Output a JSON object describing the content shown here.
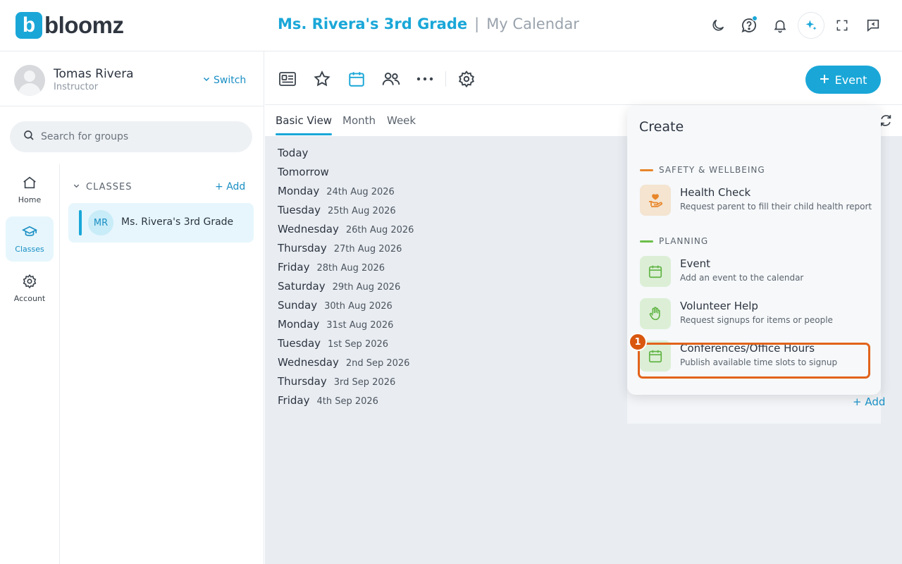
{
  "brand": {
    "logo_letter": "b",
    "name": "bloomz",
    "color": "#1aa7d8"
  },
  "header": {
    "group": "Ms. Rivera's 3rd Grade",
    "separator": "|",
    "page": "My Calendar"
  },
  "top_icons": [
    "moon-icon",
    "help-icon",
    "bell-icon",
    "ai-sparkle-icon",
    "fullscreen-icon",
    "message-icon"
  ],
  "user": {
    "name": "Tomas Rivera",
    "role": "Instructor",
    "switch_label": "Switch"
  },
  "search": {
    "placeholder": "Search for groups"
  },
  "rail": [
    {
      "label": "Home",
      "icon": "home-icon"
    },
    {
      "label": "Classes",
      "icon": "graduation-cap-icon",
      "active": true
    },
    {
      "label": "Account",
      "icon": "gear-icon"
    }
  ],
  "groups": {
    "section_label": "CLASSES",
    "add_label": "Add",
    "items": [
      {
        "initials": "MR",
        "name": "Ms. Rivera's 3rd Grade"
      }
    ]
  },
  "toolbar": {
    "event_label": "Event"
  },
  "tabs": [
    {
      "label": "Basic View",
      "active": true
    },
    {
      "label": "Month"
    },
    {
      "label": "Week"
    }
  ],
  "days": [
    {
      "day": "Today",
      "date": ""
    },
    {
      "day": "Tomorrow",
      "date": ""
    },
    {
      "day": "Monday",
      "date": "24th Aug 2026"
    },
    {
      "day": "Tuesday",
      "date": "25th Aug 2026"
    },
    {
      "day": "Wednesday",
      "date": "26th Aug 2026"
    },
    {
      "day": "Thursday",
      "date": "27th Aug 2026"
    },
    {
      "day": "Friday",
      "date": "28th Aug 2026"
    },
    {
      "day": "Saturday",
      "date": "29th Aug 2026"
    },
    {
      "day": "Sunday",
      "date": "30th Aug 2026"
    },
    {
      "day": "Monday",
      "date": "31st Aug 2026"
    },
    {
      "day": "Tuesday",
      "date": "1st Sep 2026"
    },
    {
      "day": "Wednesday",
      "date": "2nd Sep 2026"
    },
    {
      "day": "Thursday",
      "date": "3rd Sep 2026"
    },
    {
      "day": "Friday",
      "date": "4th Sep 2026"
    }
  ],
  "add_more": "+ Add",
  "create_menu": {
    "title": "Create",
    "sections": [
      {
        "label": "SAFETY & WELLBEING",
        "color": "#e8862a",
        "items": [
          {
            "name": "Health Check",
            "description": "Request parent to fill their child health report",
            "icon": "hand-heart-icon"
          }
        ]
      },
      {
        "label": "PLANNING",
        "color": "#6cbf4a",
        "items": [
          {
            "name": "Event",
            "description": "Add an event to the calendar",
            "icon": "calendar-icon"
          },
          {
            "name": "Volunteer Help",
            "description": "Request signups for items or people",
            "icon": "hand-icon"
          },
          {
            "name": "Conferences/Office Hours",
            "description": "Publish available time slots to signup",
            "icon": "calendar-icon"
          }
        ]
      }
    ]
  },
  "step_marker": "1",
  "colors": {
    "highlight": "#e2631b",
    "accent": "#1aa7d8"
  }
}
